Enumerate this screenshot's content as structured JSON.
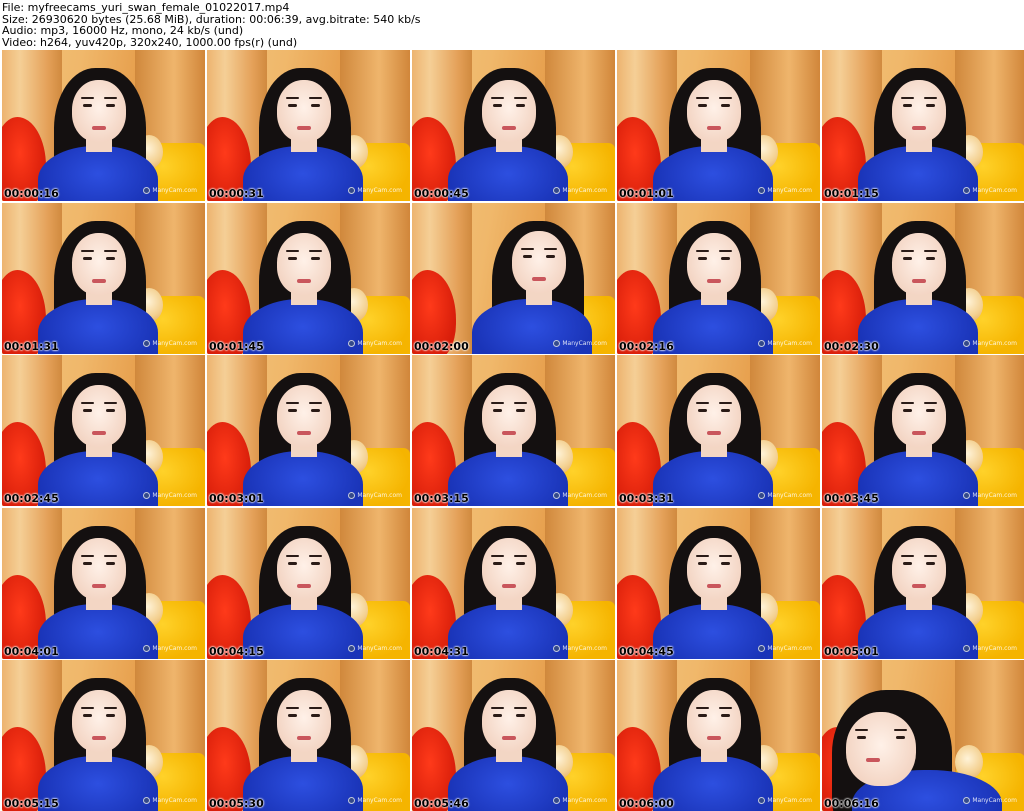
{
  "header": {
    "file_line": "File: myfreecams_yuri_swan_female_01022017.mp4",
    "size_line": "Size: 26930620 bytes (25.68 MiB), duration: 00:06:39, avg.bitrate: 540 kb/s",
    "audio_line": "Audio: mp3, 16000 Hz, mono, 24 kb/s (und)",
    "video_line": "Video: h264, yuv420p, 320x240, 1000.00 fps(r) (und)"
  },
  "watermark": "ManyCam.com",
  "thumbnails": [
    {
      "time": "00:00:16"
    },
    {
      "time": "00:00:31"
    },
    {
      "time": "00:00:45"
    },
    {
      "time": "00:01:01"
    },
    {
      "time": "00:01:15"
    },
    {
      "time": "00:01:31"
    },
    {
      "time": "00:01:45"
    },
    {
      "time": "00:02:00"
    },
    {
      "time": "00:02:16"
    },
    {
      "time": "00:02:30"
    },
    {
      "time": "00:02:45"
    },
    {
      "time": "00:03:01"
    },
    {
      "time": "00:03:15"
    },
    {
      "time": "00:03:31"
    },
    {
      "time": "00:03:45"
    },
    {
      "time": "00:04:01"
    },
    {
      "time": "00:04:15"
    },
    {
      "time": "00:04:31"
    },
    {
      "time": "00:04:45"
    },
    {
      "time": "00:05:01"
    },
    {
      "time": "00:05:15"
    },
    {
      "time": "00:05:30"
    },
    {
      "time": "00:05:46"
    },
    {
      "time": "00:06:00"
    },
    {
      "time": "00:06:16"
    }
  ]
}
